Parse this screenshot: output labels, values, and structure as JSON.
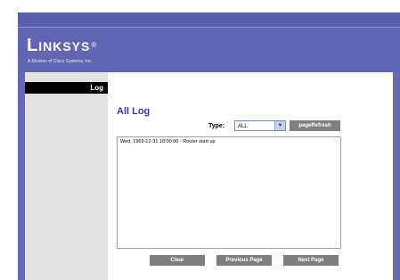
{
  "brand": {
    "logo_main": "L",
    "logo_rest": "INKSYS",
    "logo_reg": "®",
    "tagline": "A Division of Cisco Systems, Inc."
  },
  "sidebar": {
    "items": [
      {
        "label": "Log"
      }
    ]
  },
  "main": {
    "title": "All Log",
    "type_label": "Type:",
    "type_value": "ALL",
    "refresh_label": "pageRefresh",
    "log_lines": [
      "Wed, 1969-12-31 18:00:00 - Router start up"
    ],
    "buttons": {
      "clear": "Clear",
      "previous": "Previous Page",
      "next": "Next Page"
    }
  },
  "colors": {
    "header_bg": "#6668b3",
    "title_color": "#3b36b5",
    "button_bg": "#7f7f7f"
  }
}
